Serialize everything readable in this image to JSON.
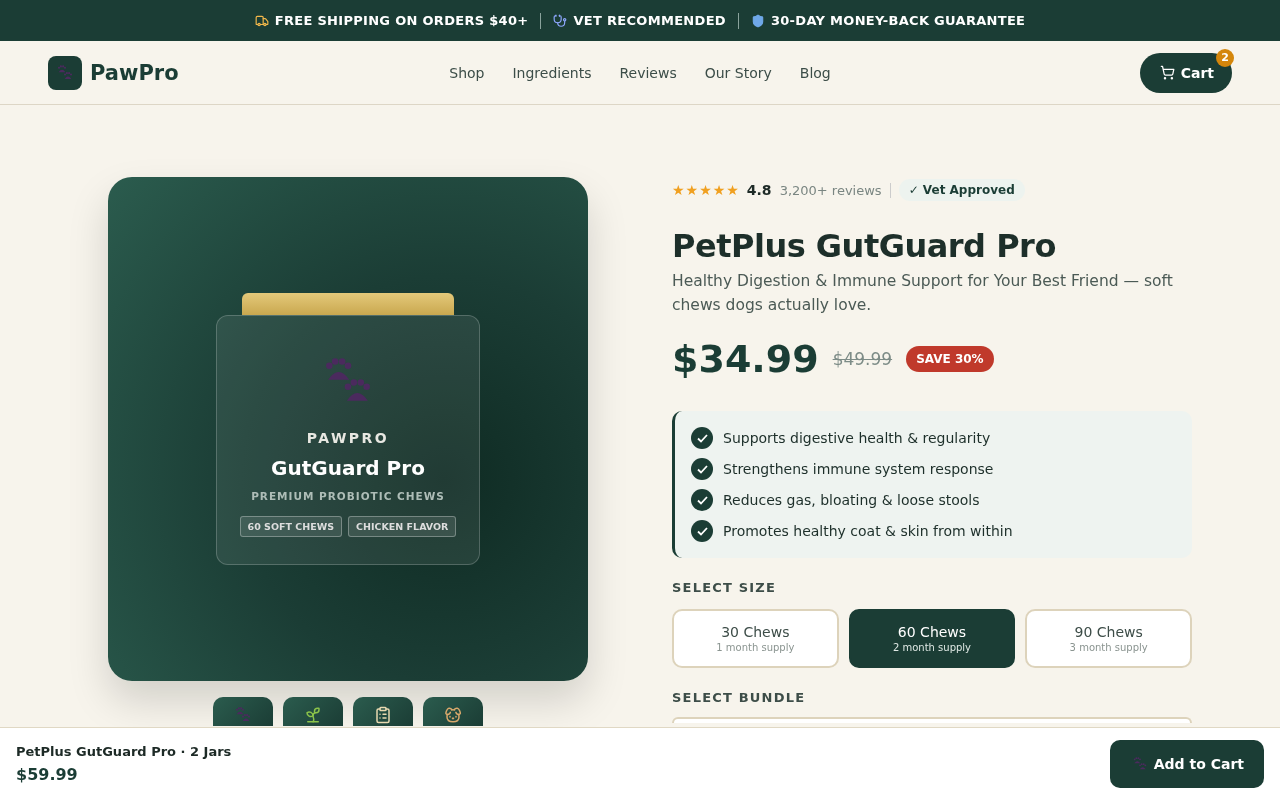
{
  "announcement": [
    {
      "kind": "truck",
      "text": "FREE SHIPPING ON ORDERS $40+"
    },
    {
      "kind": "stethoscope",
      "text": "VET RECOMMENDED"
    },
    {
      "kind": "shield",
      "text": "30-DAY MONEY-BACK GUARANTEE"
    }
  ],
  "header": {
    "brand": "PawPro",
    "nav": [
      "Shop",
      "Ingredients",
      "Reviews",
      "Our Story",
      "Blog"
    ],
    "cart": {
      "label": "Cart",
      "count": "2"
    }
  },
  "product_image": {
    "brand": "PAWPRO",
    "name": "GutGuard Pro",
    "subtitle": "PREMIUM PROBIOTIC CHEWS",
    "tags": [
      "60 SOFT CHEWS",
      "CHICKEN FLAVOR"
    ]
  },
  "thumbnails": [
    {
      "kind": "paw"
    },
    {
      "kind": "plant"
    },
    {
      "kind": "clipboard"
    },
    {
      "kind": "dog"
    }
  ],
  "rating": {
    "stars": 5,
    "score": "4.8",
    "reviews": "3,200+ reviews",
    "badge": "✓ Vet Approved"
  },
  "title": "PetPlus GutGuard Pro",
  "subtitle": "Healthy Digestion & Immune Support for Your Best Friend — soft chews dogs actually love.",
  "price": {
    "current": "$34.99",
    "original": "$49.99",
    "discount": "SAVE 30%"
  },
  "benefits": [
    "Supports digestive health & regularity",
    "Strengthens immune system response",
    "Reduces gas, bloating & loose stools",
    "Promotes healthy coat & skin from within"
  ],
  "size_label": "SELECT SIZE",
  "sizes": [
    {
      "label": "30 Chews",
      "note": "1 month supply",
      "selected": false
    },
    {
      "label": "60 Chews",
      "note": "2 month supply",
      "selected": true
    },
    {
      "label": "90 Chews",
      "note": "3 month supply",
      "selected": false
    }
  ],
  "bundle_label": "SELECT BUNDLE",
  "sticky_bar": {
    "product": "PetPlus GutGuard Pro · 2 Jars",
    "price": "$59.99",
    "button": "Add to Cart"
  }
}
